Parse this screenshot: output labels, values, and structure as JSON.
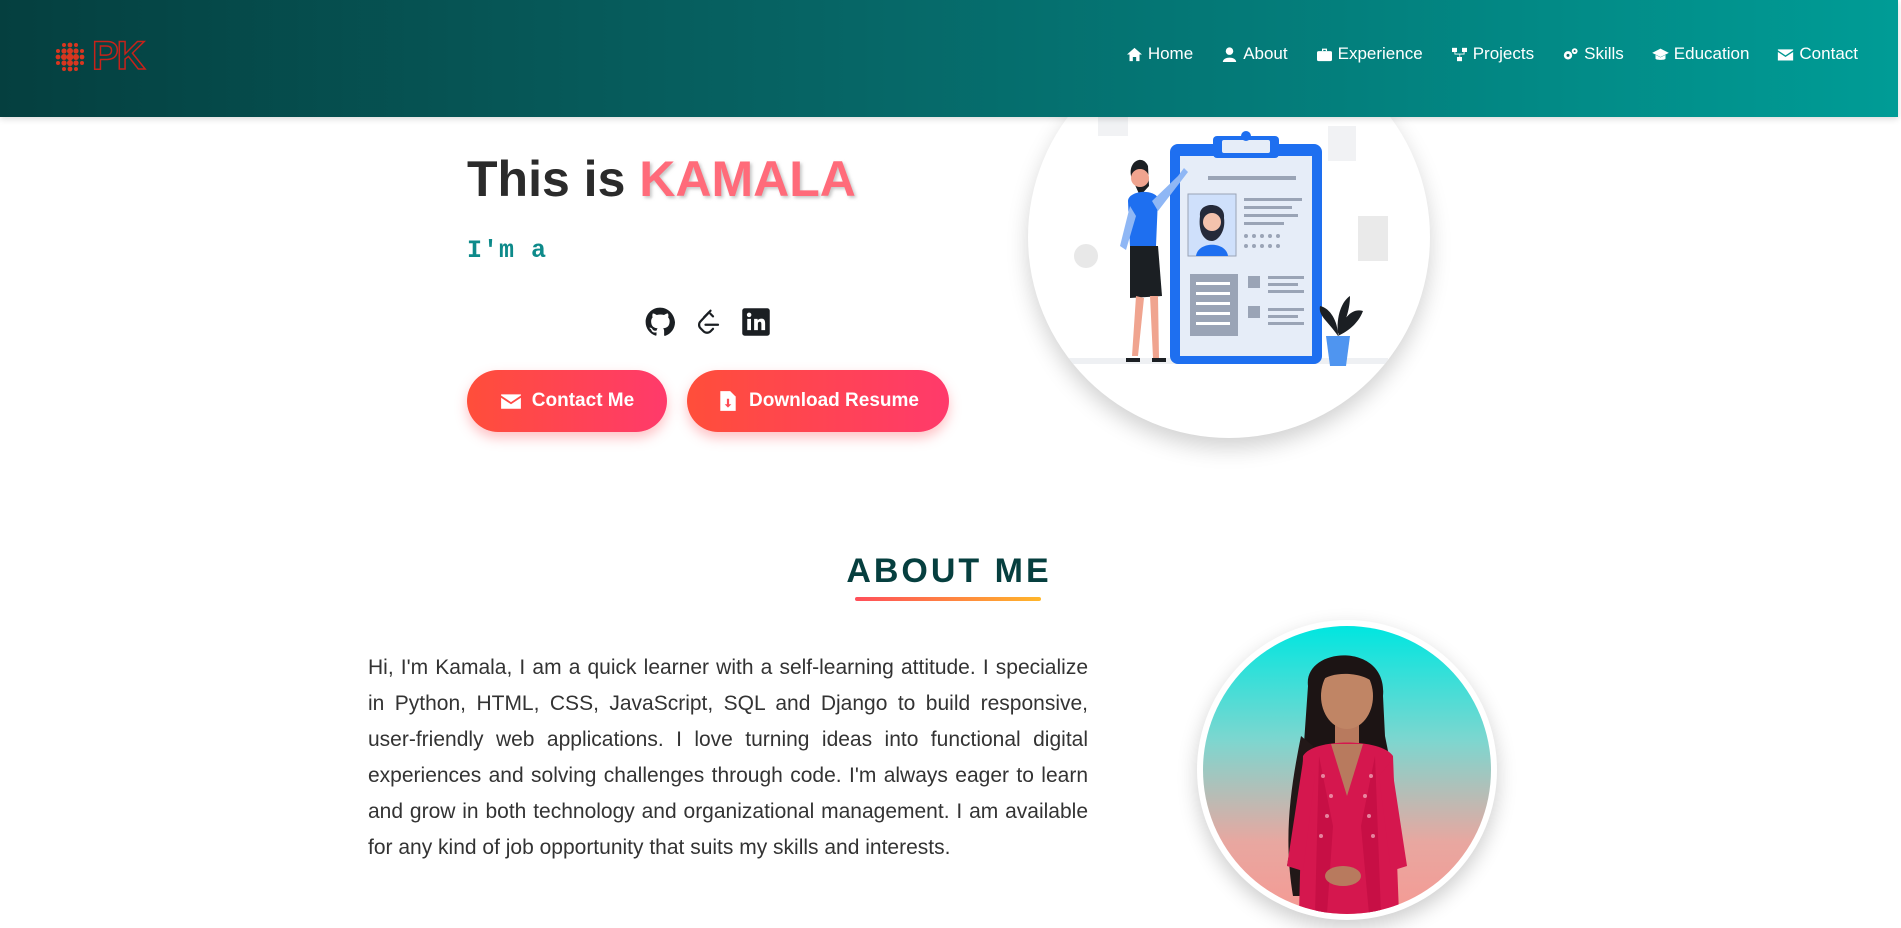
{
  "header": {
    "logo_text": "PK",
    "nav": [
      {
        "label": "Home",
        "icon": "home-icon"
      },
      {
        "label": "About",
        "icon": "user-icon"
      },
      {
        "label": "Experience",
        "icon": "briefcase-icon"
      },
      {
        "label": "Projects",
        "icon": "sitemap-icon"
      },
      {
        "label": "Skills",
        "icon": "gears-icon"
      },
      {
        "label": "Education",
        "icon": "graduation-cap-icon"
      },
      {
        "label": "Contact",
        "icon": "envelope-icon"
      }
    ],
    "colors": {
      "gradient_start": "#053f3f",
      "gradient_end": "#009c96"
    }
  },
  "hero": {
    "title_prefix": "This is ",
    "name": "KAMALA",
    "typed_text": "I'm a",
    "socials": [
      "github-icon",
      "leetcode-icon",
      "linkedin-icon"
    ],
    "contact_button": "Contact Me",
    "resume_button": "Download Resume",
    "accent_color": "#ff6b7a"
  },
  "about": {
    "title": "ABOUT ME",
    "text": "Hi, I'm Kamala, I am a quick learner with a self-learning attitude. I specialize in Python, HTML, CSS, JavaScript, SQL and Django to build responsive, user-friendly web applications. I love turning ideas into functional digital experiences and solving challenges through code. I'm always eager to learn and grow in both technology and organizational management. I am available for any kind of job opportunity that suits my skills and interests."
  }
}
